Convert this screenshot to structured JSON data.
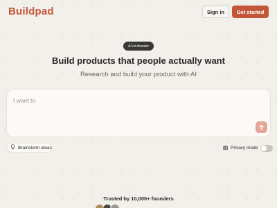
{
  "header": {
    "logo": "Buildpad",
    "sign_in_label": "Sign in",
    "get_started_label": "Get started"
  },
  "hero": {
    "badge": "AI co-founder",
    "headline": "Build products that people actually want",
    "subhead": "Research and build your product with AI"
  },
  "prompt": {
    "placeholder": "I want to"
  },
  "controls": {
    "brainstorm_label": "Brainstorm ideas",
    "privacy_label": "Privacy mode",
    "privacy_enabled": false
  },
  "social_proof": {
    "trusted_text": "Trusted by 10,000+ founders"
  },
  "colors": {
    "brand": "#c4563a",
    "send_button": "#e4a699"
  }
}
